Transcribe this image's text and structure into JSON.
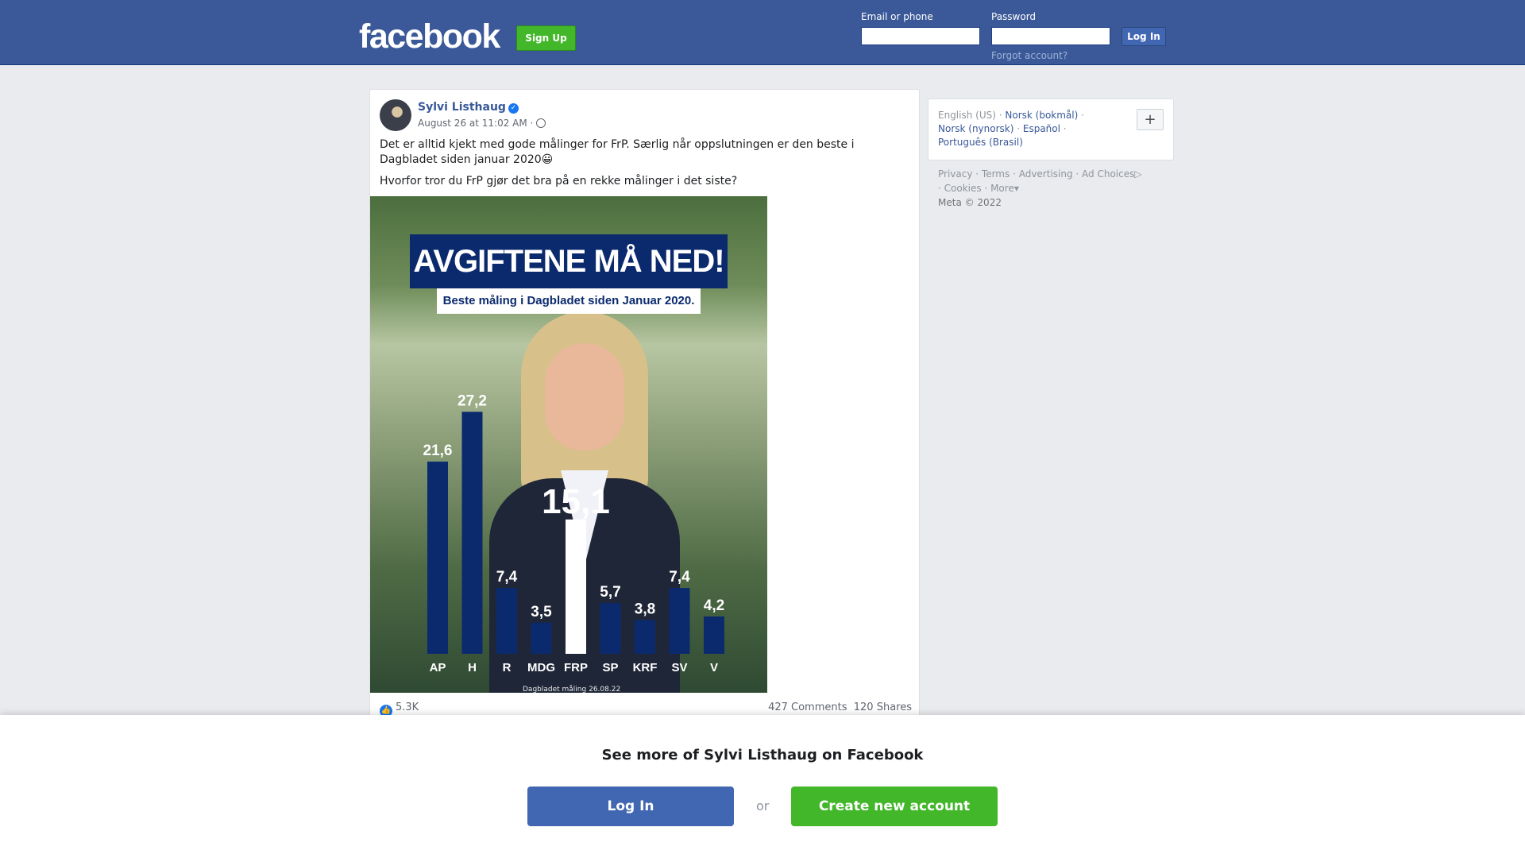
{
  "header": {
    "logo": "facebook",
    "signup_label": "Sign Up",
    "email_label": "Email or phone",
    "password_label": "Password",
    "login_label": "Log In",
    "forgot_label": "Forgot account?",
    "brand_color": "#3b5998"
  },
  "post": {
    "author": "Sylvi Listhaug",
    "verified_icon": "✓",
    "time": "August 26 at 11:02 AM ·",
    "text1": "Det er alltid kjekt med gode målinger for FrP. Særlig når oppslutningen er den beste i Dagbladet siden januar 2020😀",
    "text2": "Hvorfor tror du FrP gjør det bra på en rekke målinger i det siste?",
    "image": {
      "headline": "AVGIFTENE MÅ NED!",
      "subline": "Beste måling i Dagbladet siden Januar 2020.",
      "source": "Dagbladet måling 26.08.22"
    },
    "likes": "5.3K",
    "comments": "427 Comments",
    "shares": "120 Shares"
  },
  "chart_data": {
    "type": "bar",
    "categories": [
      "AP",
      "H",
      "R",
      "MDG",
      "FRP",
      "SP",
      "KRF",
      "SV",
      "V"
    ],
    "values": [
      21.6,
      27.2,
      7.4,
      3.5,
      15.1,
      5.7,
      3.8,
      7.4,
      4.2
    ],
    "value_labels": [
      "21,6",
      "27,2",
      "7,4",
      "3,5",
      "15,1",
      "5,7",
      "3,8",
      "7,4",
      "4,2"
    ],
    "highlight": "FRP",
    "colors": {
      "bar": "#0b2a6e",
      "highlight": "#ffffff",
      "label": "#ffffff"
    },
    "title": "",
    "ylim": [
      0,
      30
    ]
  },
  "sidebar": {
    "current_language": "English (US)",
    "languages": [
      "Norsk (bokmål)",
      "Norsk (nynorsk)",
      "Español",
      "Português (Brasil)"
    ],
    "plus_label": "+",
    "footer_links": [
      "Privacy",
      "Terms",
      "Advertising",
      "Ad Choices",
      "Cookies",
      "More"
    ],
    "copyright": "Meta © 2022"
  },
  "overlay": {
    "title": "See more of Sylvi Listhaug on Facebook",
    "login_label": "Log In",
    "or_label": "or",
    "create_label": "Create new account"
  }
}
